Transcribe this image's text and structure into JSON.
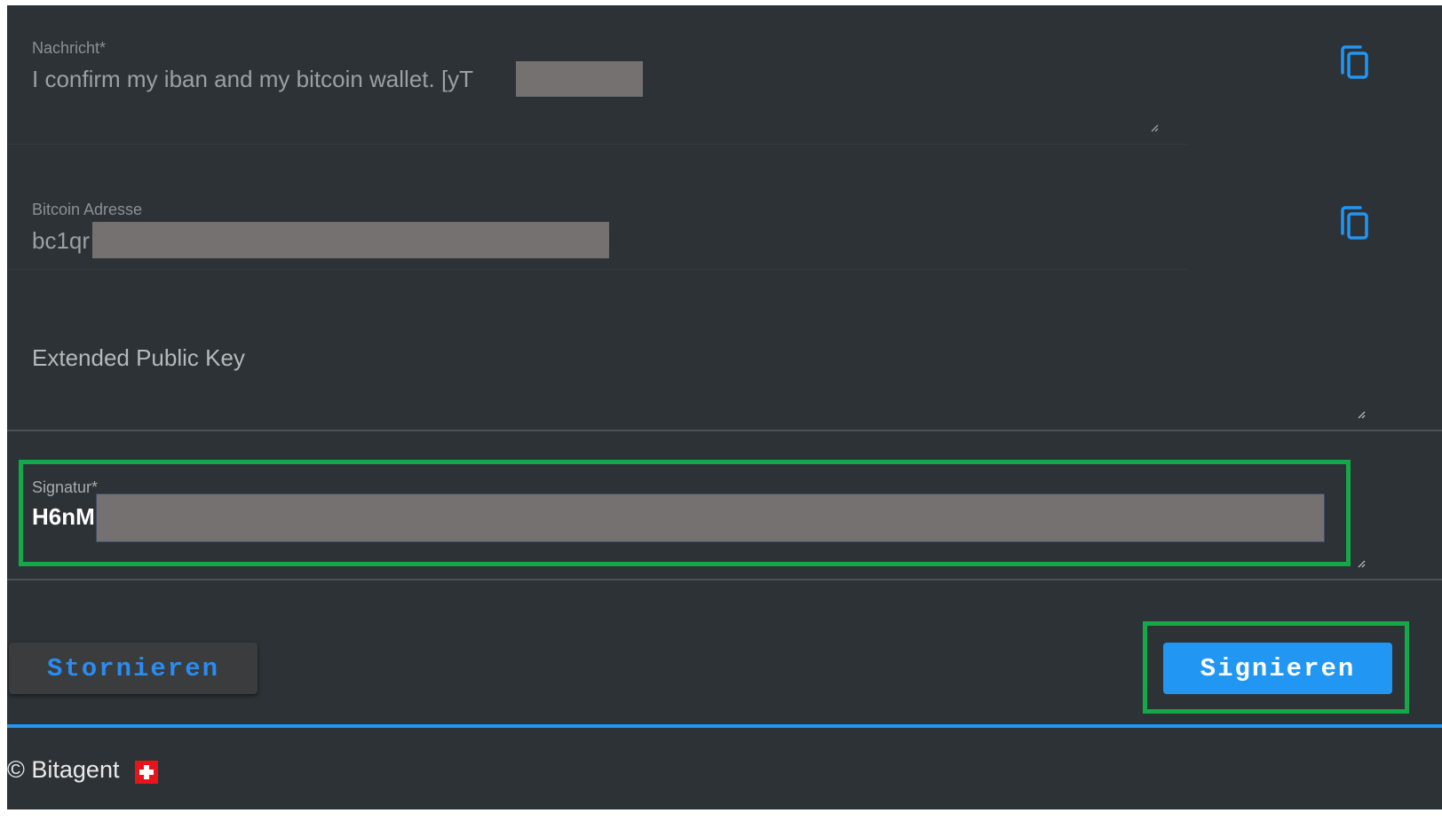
{
  "form": {
    "message": {
      "label": "Nachricht*",
      "value": "I confirm my iban and my bitcoin wallet. [yT"
    },
    "address": {
      "label": "Bitcoin Adresse",
      "value": "bc1qr"
    },
    "xpub": {
      "placeholder": "Extended Public Key"
    },
    "signature": {
      "label": "Signatur*",
      "value": "H6nM"
    }
  },
  "actions": {
    "cancel_label": "Stornieren",
    "sign_label": "Signieren"
  },
  "footer": {
    "copyright": "© Bitagent"
  },
  "icons": {
    "copy": "copy-icon",
    "resize": "resize-handle-icon",
    "flag": "swiss-flag-icon"
  },
  "colors": {
    "background": "#2c3235",
    "accent": "#2196f3",
    "highlight": "#14a84a",
    "redaction": "#757170"
  }
}
